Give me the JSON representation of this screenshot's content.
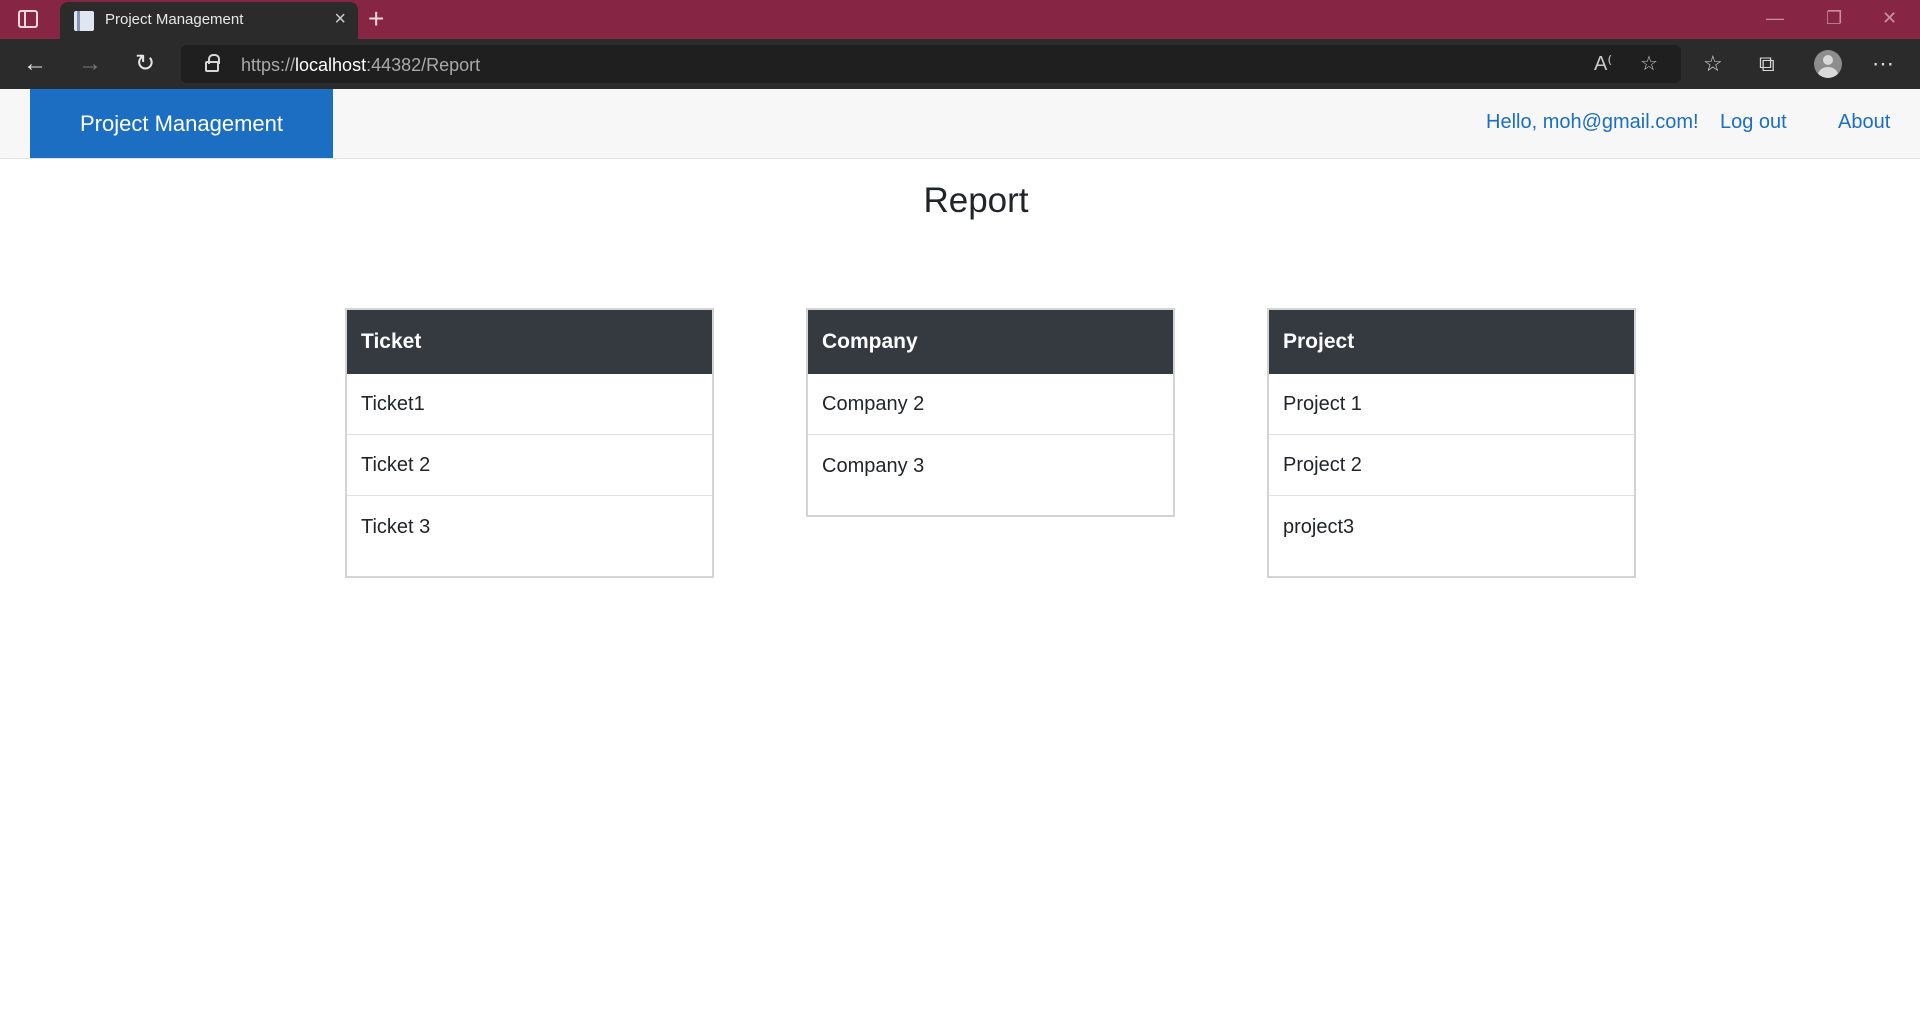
{
  "browser": {
    "tab_title": "Project Management",
    "tab_close": "×",
    "new_tab": "+",
    "url_scheme": "https://",
    "url_host": "localhost",
    "url_rest": ":44382/Report"
  },
  "navbar": {
    "brand": "Project Management",
    "greeting": "Hello, moh@gmail.com!",
    "logout": "Log out",
    "about": "About"
  },
  "page": {
    "title": "Report"
  },
  "cards": [
    {
      "header": "Ticket",
      "items": [
        "Ticket1",
        "Ticket 2",
        "Ticket 3"
      ]
    },
    {
      "header": "Company",
      "items": [
        "Company 2",
        "Company 3"
      ]
    },
    {
      "header": "Project",
      "items": [
        "Project 1",
        "Project 2",
        "project3"
      ]
    }
  ],
  "colors": {
    "titlebar": "#872644",
    "brand_bg": "#1b6ec2",
    "link": "#1b6ec2",
    "card_header": "#343a40"
  }
}
